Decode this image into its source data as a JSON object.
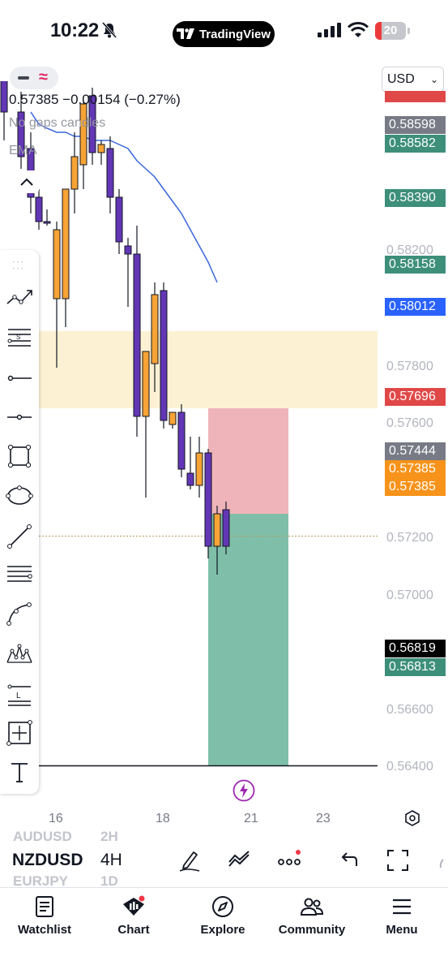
{
  "status_bar": {
    "time": "10:22",
    "brand": "TradingView",
    "battery": "20",
    "battery_level": 0.2
  },
  "header": {
    "price_line": "0.57385 −0.00154 (−0.27%)",
    "study_1": "No gaps candles",
    "study_2": "EMA",
    "currency": "USD"
  },
  "price_axis": {
    "ticks": [
      "0.58200",
      "0.57800",
      "0.57600",
      "0.57200",
      "0.57000",
      "0.56600",
      "0.56400"
    ],
    "labels": [
      {
        "value": "0.58598",
        "color": "#787b86"
      },
      {
        "value": "0.58582",
        "color": "#3d8f7a"
      },
      {
        "value": "0.58390",
        "color": "#3d8f7a"
      },
      {
        "value": "0.58158",
        "color": "#3d8f7a"
      },
      {
        "value": "0.58012",
        "color": "#2962ff"
      },
      {
        "value": "0.57696",
        "color": "#e04848"
      },
      {
        "value": "0.57444",
        "color": "#787b86"
      },
      {
        "value": "0.57385",
        "color": "#f7931a"
      },
      {
        "value": "0.57385",
        "color": "#f7931a"
      },
      {
        "value": "0.56819",
        "color": "#000000"
      },
      {
        "value": "0.56813",
        "color": "#3d8f7a"
      }
    ]
  },
  "time_axis": [
    "16",
    "18",
    "21",
    "23"
  ],
  "symbol_bar": {
    "prev_symbol": "AUDUSD",
    "prev_tf": "2H",
    "symbol": "NZDUSD",
    "timeframe": "4H",
    "next_symbol": "EURJPY",
    "next_tf": "1D"
  },
  "toolbar": {
    "tools": [
      "trend-line-icon",
      "long-position-icon",
      "horizontal-ray-icon",
      "horizontal-line-icon",
      "rectangle-icon",
      "ellipse-icon",
      "line-icon",
      "fib-retracement-icon",
      "curve-icon",
      "pattern-icon",
      "price-label-icon",
      "crosshair-icon",
      "text-icon"
    ]
  },
  "bottom_nav": [
    {
      "label": "Watchlist",
      "icon": "watchlist-icon"
    },
    {
      "label": "Chart",
      "icon": "chart-icon"
    },
    {
      "label": "Explore",
      "icon": "explore-icon"
    },
    {
      "label": "Community",
      "icon": "community-icon"
    },
    {
      "label": "Menu",
      "icon": "menu-icon"
    }
  ],
  "colors": {
    "bull": "#f7a335",
    "bear": "#6236b5",
    "ema": "#3a66d8",
    "stop_zone": "#eeb4b9",
    "target_zone": "#7fbfaa",
    "supply_zone": "#fdf1d4"
  },
  "chart_data": {
    "type": "candlestick",
    "candles": [
      {
        "o": 0.5863,
        "h": 0.5868,
        "l": 0.5836,
        "c": 0.5843,
        "dir": "down"
      },
      {
        "o": 0.5843,
        "h": 0.5848,
        "l": 0.5829,
        "c": 0.5832,
        "dir": "down"
      },
      {
        "o": 0.5834,
        "h": 0.5838,
        "l": 0.5818,
        "c": 0.5822,
        "dir": "down"
      },
      {
        "o": 0.5822,
        "h": 0.5824,
        "l": 0.5814,
        "c": 0.5816,
        "dir": "down"
      },
      {
        "o": 0.5816,
        "h": 0.5819,
        "l": 0.5815,
        "c": 0.5816,
        "dir": "down"
      },
      {
        "o": 0.5814,
        "h": 0.5816,
        "l": 0.578,
        "c": 0.5797,
        "dir": "up"
      },
      {
        "o": 0.5797,
        "h": 0.5824,
        "l": 0.579,
        "c": 0.5824,
        "dir": "up"
      },
      {
        "o": 0.5824,
        "h": 0.5838,
        "l": 0.5818,
        "c": 0.5832,
        "dir": "up"
      },
      {
        "o": 0.583,
        "h": 0.5846,
        "l": 0.5824,
        "c": 0.5845,
        "dir": "up"
      },
      {
        "o": 0.5847,
        "h": 0.5849,
        "l": 0.583,
        "c": 0.5833,
        "dir": "down"
      },
      {
        "o": 0.5833,
        "h": 0.5836,
        "l": 0.583,
        "c": 0.5835,
        "dir": "up"
      },
      {
        "o": 0.5834,
        "h": 0.5837,
        "l": 0.5818,
        "c": 0.5822,
        "dir": "down"
      },
      {
        "o": 0.5822,
        "h": 0.5824,
        "l": 0.5808,
        "c": 0.5811,
        "dir": "down"
      },
      {
        "o": 0.581,
        "h": 0.5812,
        "l": 0.5795,
        "c": 0.5808,
        "dir": "down"
      },
      {
        "o": 0.5808,
        "h": 0.5815,
        "l": 0.5763,
        "c": 0.5768,
        "dir": "down"
      },
      {
        "o": 0.5768,
        "h": 0.5784,
        "l": 0.5748,
        "c": 0.5784,
        "dir": "up"
      },
      {
        "o": 0.5781,
        "h": 0.5801,
        "l": 0.5774,
        "c": 0.5798,
        "dir": "up"
      },
      {
        "o": 0.5799,
        "h": 0.5801,
        "l": 0.5765,
        "c": 0.5767,
        "dir": "down"
      },
      {
        "o": 0.5766,
        "h": 0.5769,
        "l": 0.5765,
        "c": 0.5769,
        "dir": "up"
      },
      {
        "o": 0.5769,
        "h": 0.5771,
        "l": 0.5753,
        "c": 0.5755,
        "dir": "down"
      },
      {
        "o": 0.5754,
        "h": 0.5763,
        "l": 0.575,
        "c": 0.5751,
        "dir": "down"
      },
      {
        "o": 0.5751,
        "h": 0.5763,
        "l": 0.5748,
        "c": 0.5759,
        "dir": "up"
      },
      {
        "o": 0.5759,
        "h": 0.576,
        "l": 0.5733,
        "c": 0.5736,
        "dir": "down"
      },
      {
        "o": 0.5736,
        "h": 0.5746,
        "l": 0.5729,
        "c": 0.5744,
        "dir": "up"
      },
      {
        "o": 0.5745,
        "h": 0.5747,
        "l": 0.5734,
        "c": 0.5736,
        "dir": "down"
      }
    ],
    "ema": [
      0.5843,
      0.584,
      0.5839,
      0.5838,
      0.5838,
      0.5837,
      0.5837,
      0.5836,
      0.5836,
      0.5836,
      0.5835,
      0.5834,
      0.5831,
      0.5829,
      0.5827,
      0.5824,
      0.5821,
      0.5818,
      0.5814,
      0.581,
      0.5806,
      0.5801
    ],
    "y_range": [
      0.5628,
      0.5875
    ],
    "supply_zone": [
      0.577,
      0.5789
    ],
    "stop_zone": [
      0.5744,
      0.577
    ],
    "target_zone": [
      0.56819,
      0.5744
    ],
    "entry_level": 0.57385,
    "horizontal_line": 0.56819
  }
}
